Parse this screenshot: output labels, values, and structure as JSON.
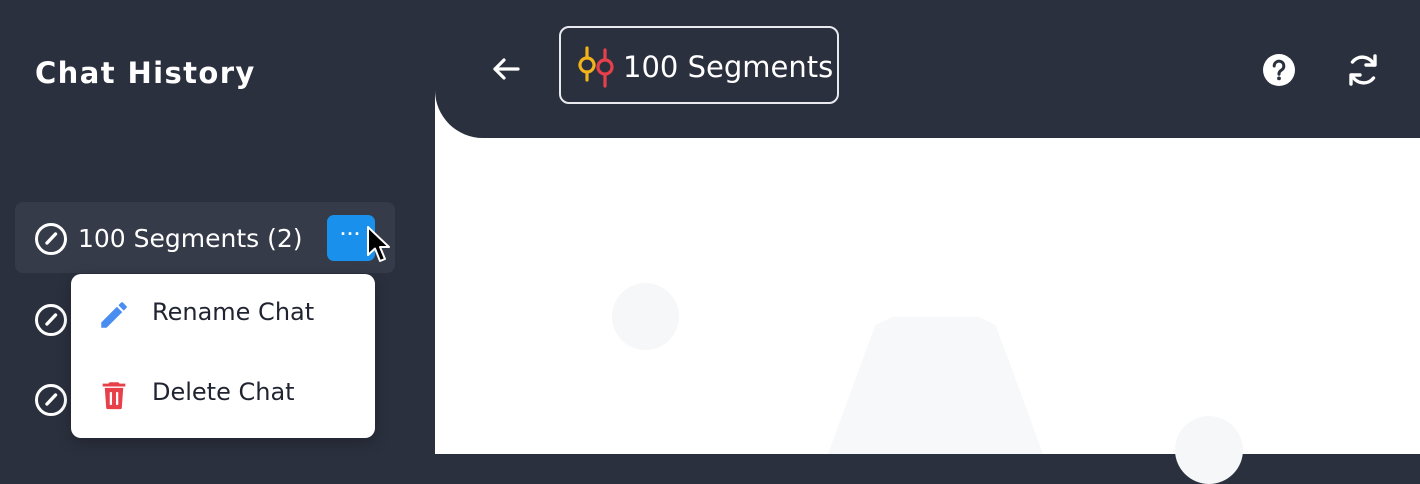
{
  "sidebar": {
    "title": "Chat History",
    "active_item": {
      "label": "100 Segments (2)",
      "more_label": "···"
    }
  },
  "context_menu": {
    "items": [
      {
        "label": "Rename Chat",
        "icon": "pencil-icon",
        "color": "#4a8df0"
      },
      {
        "label": "Delete Chat",
        "icon": "trash-icon",
        "color": "#e8404a"
      }
    ]
  },
  "header": {
    "back_icon": "arrow-left-icon",
    "segment_button_label": "100 Segments",
    "segment_icon": "segments-icon",
    "help_icon": "question-circle-icon",
    "refresh_icon": "refresh-icon"
  },
  "colors": {
    "sidebar_bg": "#2b303e",
    "accent": "#1991ec",
    "segment_yellow": "#f3b31b",
    "segment_red": "#e8404a"
  }
}
